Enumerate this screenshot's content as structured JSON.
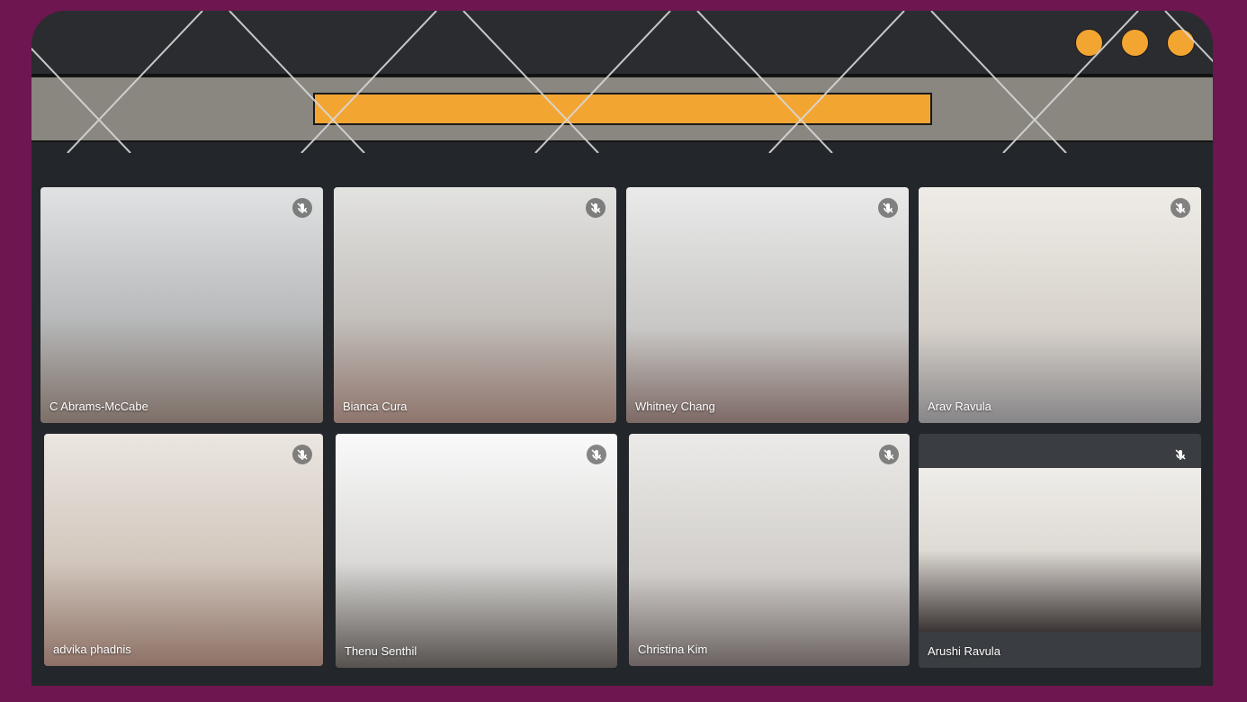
{
  "colors": {
    "background": "#6e1650",
    "window": "#23262a",
    "accent": "#f3a532",
    "addressbar": "#8a8680"
  },
  "window_controls": [
    {
      "icon": "circle-icon"
    },
    {
      "icon": "circle-icon"
    },
    {
      "icon": "circle-icon"
    }
  ],
  "participants": [
    {
      "name": "C Abrams-McCabe",
      "mic_icon": "mic-off-icon",
      "muted": true
    },
    {
      "name": "Bianca Cura",
      "mic_icon": "mic-off-icon",
      "muted": true
    },
    {
      "name": "Whitney Chang",
      "mic_icon": "mic-off-icon",
      "muted": true
    },
    {
      "name": "Arav Ravula",
      "mic_icon": "mic-off-icon",
      "muted": true
    },
    {
      "name": "advika phadnis",
      "mic_icon": "mic-off-icon",
      "muted": true
    },
    {
      "name": "Thenu Senthil",
      "mic_icon": "mic-off-icon",
      "muted": true
    },
    {
      "name": "Christina Kim",
      "mic_icon": "mic-off-icon",
      "muted": true
    },
    {
      "name": "Arushi Ravula",
      "mic_icon": "mic-off-icon",
      "muted": true
    }
  ]
}
